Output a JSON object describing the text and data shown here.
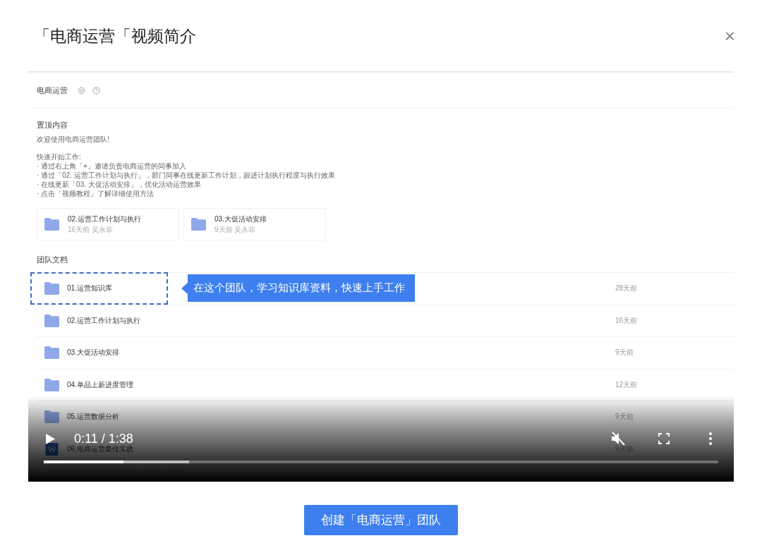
{
  "dialog": {
    "title": "「电商运营「视频简介",
    "close": "×"
  },
  "video": {
    "app": {
      "team_name": "电商运营",
      "pinned": {
        "heading": "置顶内容",
        "welcome": "欢迎使用电商运营团队!",
        "lines": [
          "快速开始工作:",
          "· 通过右上角「+」邀请负责电商运营的同事加入",
          "· 通过「02. 运营工作计划与执行」，部门同事在线更新工作计划，跟进计划执行程度与执行效果",
          "· 在线更新「03. 大促活动安排」，优化活动运营效果",
          "· 点击「视频教程」了解详细使用方法"
        ],
        "cards": [
          {
            "name": "02.运营工作计划与执行",
            "meta": "16天前 吴永菲"
          },
          {
            "name": "03.大促活动安排",
            "meta": "9天前 吴永菲"
          }
        ]
      },
      "docs": {
        "heading": "团队文档",
        "rows": [
          {
            "kind": "folder",
            "name": "01.运营知识库",
            "time": "28天前",
            "highlighted": true
          },
          {
            "kind": "folder",
            "name": "02.运营工作计划与执行",
            "time": "16天前",
            "highlighted": false
          },
          {
            "kind": "folder",
            "name": "03.大促活动安排",
            "time": "9天前",
            "highlighted": false
          },
          {
            "kind": "folder",
            "name": "04.单品上新进度管理",
            "time": "12天前",
            "highlighted": false
          },
          {
            "kind": "folder",
            "name": "05.运营数据分析",
            "time": "9天前",
            "highlighted": false
          },
          {
            "kind": "doc",
            "name": "06.电商运营最佳实践",
            "time": "9天前",
            "highlighted": false
          }
        ]
      },
      "callout": "在这个团队，学习知识库资料，快速上手工作"
    },
    "controls": {
      "playing": false,
      "time": "0:11 / 1:38",
      "muted": true,
      "progress": {
        "level": 0.118,
        "buffered": {
          "level": 0.215
        }
      }
    }
  },
  "primary_button": "创建「电商运营」团队"
}
